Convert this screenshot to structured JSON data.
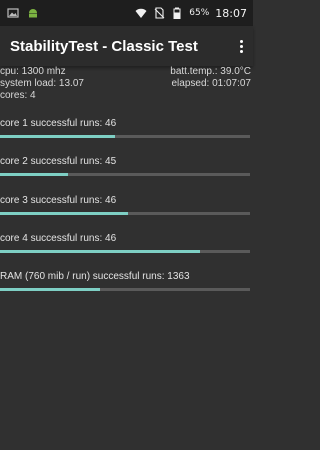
{
  "status_bar": {
    "battery_percent": "65%",
    "clock": "18:07",
    "icons": [
      "image-icon",
      "android-icon",
      "wifi-icon",
      "no-sim-icon",
      "battery-icon"
    ]
  },
  "app_bar": {
    "title": "StabilityTest - Classic Test",
    "menu_icon": "overflow-menu-icon"
  },
  "info": {
    "cpu": "cpu: 1300 mhz",
    "batt_temp": "batt.temp.: 39.0°C",
    "system_load": "system load: 13.07",
    "elapsed": "elapsed: 01:07:07",
    "cores": "cores: 4"
  },
  "tests": [
    {
      "label": "core 1 successful runs: 46",
      "progress": 0.46
    },
    {
      "label": "core 2 successful runs: 45",
      "progress": 0.27
    },
    {
      "label": "core 3 successful runs: 46",
      "progress": 0.51
    },
    {
      "label": "core 4 successful runs: 46",
      "progress": 0.8
    },
    {
      "label": "RAM (760 mib / run) successful runs: 1363",
      "progress": 0.4
    }
  ],
  "colors": {
    "accent": "#7ecfc4",
    "track": "#5a5a5a",
    "background": "#303030"
  }
}
